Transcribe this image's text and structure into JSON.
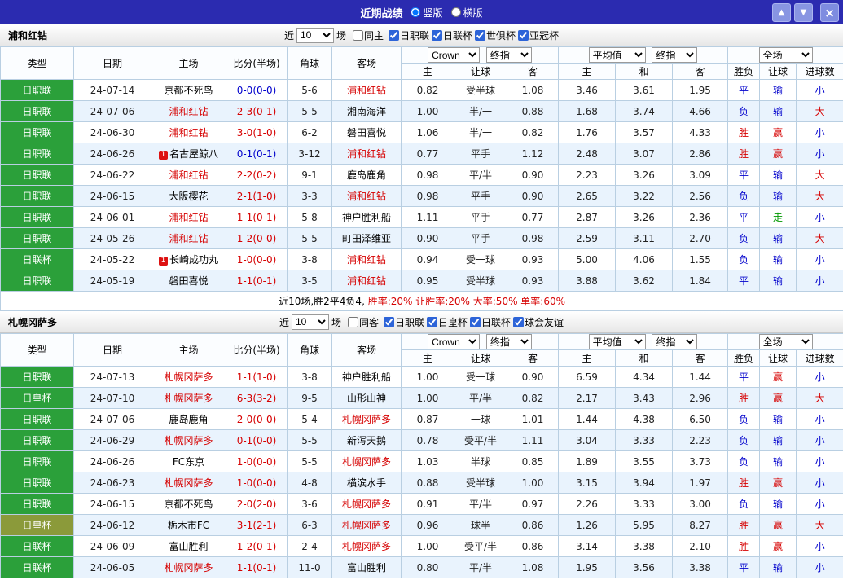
{
  "topbar": {
    "title": "近期战绩",
    "radios": [
      {
        "label": "竖版",
        "checked": true
      },
      {
        "label": "横版",
        "checked": false
      }
    ],
    "up": "▲",
    "down": "▼",
    "close": "×"
  },
  "columns": {
    "type": "类型",
    "date": "日期",
    "home": "主场",
    "score": "比分(半场)",
    "corner": "角球",
    "away": "客场",
    "sub": [
      "主",
      "让球",
      "客",
      "主",
      "和",
      "客"
    ],
    "result": "胜负",
    "handicap": "让球",
    "goals": "进球数"
  },
  "colors": {
    "green": "#2ba03a",
    "olive": "#8b9a3a",
    "focus": "#d60000",
    "score_red": "#d60000",
    "score_blue": "#0000cc",
    "win": "#d60000",
    "draw": "#0000cc",
    "lose": "#0000cc",
    "push": "#009900",
    "big": "#d60000",
    "small": "#0000cc",
    "accent": "#2b2bb0"
  },
  "sections": [
    {
      "team": "浦和红钻",
      "filter": {
        "near": "近",
        "count": "10",
        "games": "场",
        "same": "同主",
        "same_checked": false,
        "leagues": [
          "日职联",
          "日联杯",
          "世俱杯",
          "亚冠杯"
        ]
      },
      "selects": [
        "Crown",
        "终指",
        "平均值",
        "终指",
        "全场"
      ],
      "rows": [
        {
          "t": "日职联",
          "lc": "green",
          "d": "24-07-14",
          "h": "京都不死鸟",
          "hf": false,
          "hb": null,
          "s": "0-0(0-0)",
          "sc": "blue",
          "cn": "5-6",
          "a": "浦和红钻",
          "af": true,
          "o": [
            "0.82",
            "受半球",
            "1.08"
          ],
          "v": [
            "3.46",
            "3.61",
            "1.95"
          ],
          "r": "平",
          "l": "输",
          "g": "小"
        },
        {
          "t": "日职联",
          "lc": "green",
          "d": "24-07-06",
          "h": "浦和红钻",
          "hf": true,
          "hb": null,
          "s": "2-3(0-1)",
          "sc": "red",
          "cn": "5-5",
          "a": "湘南海洋",
          "af": false,
          "o": [
            "1.00",
            "半/一",
            "0.88"
          ],
          "v": [
            "1.68",
            "3.74",
            "4.66"
          ],
          "r": "负",
          "l": "输",
          "g": "大"
        },
        {
          "t": "日职联",
          "lc": "green",
          "d": "24-06-30",
          "h": "浦和红钻",
          "hf": true,
          "hb": null,
          "s": "3-0(1-0)",
          "sc": "red",
          "cn": "6-2",
          "a": "磐田喜悦",
          "af": false,
          "o": [
            "1.06",
            "半/一",
            "0.82"
          ],
          "v": [
            "1.76",
            "3.57",
            "4.33"
          ],
          "r": "胜",
          "l": "赢",
          "g": "小"
        },
        {
          "t": "日职联",
          "lc": "green",
          "d": "24-06-26",
          "h": "名古屋鲸八",
          "hf": false,
          "hb": "1",
          "s": "0-1(0-1)",
          "sc": "blue",
          "cn": "3-12",
          "a": "浦和红钻",
          "af": true,
          "o": [
            "0.77",
            "平手",
            "1.12"
          ],
          "v": [
            "2.48",
            "3.07",
            "2.86"
          ],
          "r": "胜",
          "l": "赢",
          "g": "小"
        },
        {
          "t": "日职联",
          "lc": "green",
          "d": "24-06-22",
          "h": "浦和红钻",
          "hf": true,
          "hb": null,
          "s": "2-2(0-2)",
          "sc": "red",
          "cn": "9-1",
          "a": "鹿岛鹿角",
          "af": false,
          "o": [
            "0.98",
            "平/半",
            "0.90"
          ],
          "v": [
            "2.23",
            "3.26",
            "3.09"
          ],
          "r": "平",
          "l": "输",
          "g": "大"
        },
        {
          "t": "日职联",
          "lc": "green",
          "d": "24-06-15",
          "h": "大阪樱花",
          "hf": false,
          "hb": null,
          "s": "2-1(1-0)",
          "sc": "red",
          "cn": "3-3",
          "a": "浦和红钻",
          "af": true,
          "o": [
            "0.98",
            "平手",
            "0.90"
          ],
          "v": [
            "2.65",
            "3.22",
            "2.56"
          ],
          "r": "负",
          "l": "输",
          "g": "大"
        },
        {
          "t": "日职联",
          "lc": "green",
          "d": "24-06-01",
          "h": "浦和红钻",
          "hf": true,
          "hb": null,
          "s": "1-1(0-1)",
          "sc": "red",
          "cn": "5-8",
          "a": "神户胜利船",
          "af": false,
          "o": [
            "1.11",
            "平手",
            "0.77"
          ],
          "v": [
            "2.87",
            "3.26",
            "2.36"
          ],
          "r": "平",
          "l": "走",
          "g": "小"
        },
        {
          "t": "日职联",
          "lc": "green",
          "d": "24-05-26",
          "h": "浦和红钻",
          "hf": true,
          "hb": null,
          "s": "1-2(0-0)",
          "sc": "red",
          "cn": "5-5",
          "a": "町田泽维亚",
          "af": false,
          "o": [
            "0.90",
            "平手",
            "0.98"
          ],
          "v": [
            "2.59",
            "3.11",
            "2.70"
          ],
          "r": "负",
          "l": "输",
          "g": "大"
        },
        {
          "t": "日联杯",
          "lc": "green",
          "d": "24-05-22",
          "h": "长崎成功丸",
          "hf": false,
          "hb": "1",
          "s": "1-0(0-0)",
          "sc": "red",
          "cn": "3-8",
          "a": "浦和红钻",
          "af": true,
          "o": [
            "0.94",
            "受一球",
            "0.93"
          ],
          "v": [
            "5.00",
            "4.06",
            "1.55"
          ],
          "r": "负",
          "l": "输",
          "g": "小"
        },
        {
          "t": "日职联",
          "lc": "green",
          "d": "24-05-19",
          "h": "磐田喜悦",
          "hf": false,
          "hb": null,
          "s": "1-1(0-1)",
          "sc": "red",
          "cn": "3-5",
          "a": "浦和红钻",
          "af": true,
          "o": [
            "0.95",
            "受半球",
            "0.93"
          ],
          "v": [
            "3.88",
            "3.62",
            "1.84"
          ],
          "r": "平",
          "l": "输",
          "g": "小"
        }
      ],
      "summary": {
        "prefix": "近10场,胜2平4负4,",
        "stats": [
          "胜率:20%",
          "让胜率:20%",
          "大率:50%",
          "单率:60%"
        ]
      }
    },
    {
      "team": "札幌冈萨多",
      "filter": {
        "near": "近",
        "count": "10",
        "games": "场",
        "same": "同客",
        "same_checked": false,
        "leagues": [
          "日职联",
          "日皇杯",
          "日联杯",
          "球会友谊"
        ]
      },
      "selects": [
        "Crown",
        "终指",
        "平均值",
        "终指",
        "全场"
      ],
      "rows": [
        {
          "t": "日职联",
          "lc": "green",
          "d": "24-07-13",
          "h": "札幌冈萨多",
          "hf": true,
          "hb": null,
          "s": "1-1(1-0)",
          "sc": "red",
          "cn": "3-8",
          "a": "神户胜利船",
          "af": false,
          "o": [
            "1.00",
            "受一球",
            "0.90"
          ],
          "v": [
            "6.59",
            "4.34",
            "1.44"
          ],
          "r": "平",
          "l": "赢",
          "g": "小"
        },
        {
          "t": "日皇杯",
          "lc": "green",
          "d": "24-07-10",
          "h": "札幌冈萨多",
          "hf": true,
          "hb": null,
          "s": "6-3(3-2)",
          "sc": "red",
          "cn": "9-5",
          "a": "山形山神",
          "af": false,
          "o": [
            "1.00",
            "平/半",
            "0.82"
          ],
          "v": [
            "2.17",
            "3.43",
            "2.96"
          ],
          "r": "胜",
          "l": "赢",
          "g": "大"
        },
        {
          "t": "日职联",
          "lc": "green",
          "d": "24-07-06",
          "h": "鹿岛鹿角",
          "hf": false,
          "hb": null,
          "s": "2-0(0-0)",
          "sc": "red",
          "cn": "5-4",
          "a": "札幌冈萨多",
          "af": true,
          "o": [
            "0.87",
            "一球",
            "1.01"
          ],
          "v": [
            "1.44",
            "4.38",
            "6.50"
          ],
          "r": "负",
          "l": "输",
          "g": "小"
        },
        {
          "t": "日职联",
          "lc": "green",
          "d": "24-06-29",
          "h": "札幌冈萨多",
          "hf": true,
          "hb": null,
          "s": "0-1(0-0)",
          "sc": "red",
          "cn": "5-5",
          "a": "新泻天鹅",
          "af": false,
          "o": [
            "0.78",
            "受平/半",
            "1.11"
          ],
          "v": [
            "3.04",
            "3.33",
            "2.23"
          ],
          "r": "负",
          "l": "输",
          "g": "小"
        },
        {
          "t": "日职联",
          "lc": "green",
          "d": "24-06-26",
          "h": "FC东京",
          "hf": false,
          "hb": null,
          "s": "1-0(0-0)",
          "sc": "red",
          "cn": "5-5",
          "a": "札幌冈萨多",
          "af": true,
          "o": [
            "1.03",
            "半球",
            "0.85"
          ],
          "v": [
            "1.89",
            "3.55",
            "3.73"
          ],
          "r": "负",
          "l": "输",
          "g": "小"
        },
        {
          "t": "日职联",
          "lc": "green",
          "d": "24-06-23",
          "h": "札幌冈萨多",
          "hf": true,
          "hb": null,
          "s": "1-0(0-0)",
          "sc": "red",
          "cn": "4-8",
          "a": "横滨水手",
          "af": false,
          "o": [
            "0.88",
            "受半球",
            "1.00"
          ],
          "v": [
            "3.15",
            "3.94",
            "1.97"
          ],
          "r": "胜",
          "l": "赢",
          "g": "小"
        },
        {
          "t": "日职联",
          "lc": "green",
          "d": "24-06-15",
          "h": "京都不死鸟",
          "hf": false,
          "hb": null,
          "s": "2-0(2-0)",
          "sc": "red",
          "cn": "3-6",
          "a": "札幌冈萨多",
          "af": true,
          "o": [
            "0.91",
            "平/半",
            "0.97"
          ],
          "v": [
            "2.26",
            "3.33",
            "3.00"
          ],
          "r": "负",
          "l": "输",
          "g": "小"
        },
        {
          "t": "日皇杯",
          "lc": "olive",
          "d": "24-06-12",
          "h": "栃木市FC",
          "hf": false,
          "hb": null,
          "s": "3-1(2-1)",
          "sc": "red",
          "cn": "6-3",
          "a": "札幌冈萨多",
          "af": true,
          "o": [
            "0.96",
            "球半",
            "0.86"
          ],
          "v": [
            "1.26",
            "5.95",
            "8.27"
          ],
          "r": "胜",
          "l": "赢",
          "g": "大"
        },
        {
          "t": "日联杯",
          "lc": "green",
          "d": "24-06-09",
          "h": "富山胜利",
          "hf": false,
          "hb": null,
          "s": "1-2(0-1)",
          "sc": "red",
          "cn": "2-4",
          "a": "札幌冈萨多",
          "af": true,
          "o": [
            "1.00",
            "受平/半",
            "0.86"
          ],
          "v": [
            "3.14",
            "3.38",
            "2.10"
          ],
          "r": "胜",
          "l": "赢",
          "g": "小"
        },
        {
          "t": "日联杯",
          "lc": "green",
          "d": "24-06-05",
          "h": "札幌冈萨多",
          "hf": true,
          "hb": null,
          "s": "1-1(0-1)",
          "sc": "red",
          "cn": "11-0",
          "a": "富山胜利",
          "af": false,
          "o": [
            "0.80",
            "平/半",
            "1.08"
          ],
          "v": [
            "1.95",
            "3.56",
            "3.38"
          ],
          "r": "平",
          "l": "输",
          "g": "小"
        }
      ],
      "summary": null
    }
  ]
}
